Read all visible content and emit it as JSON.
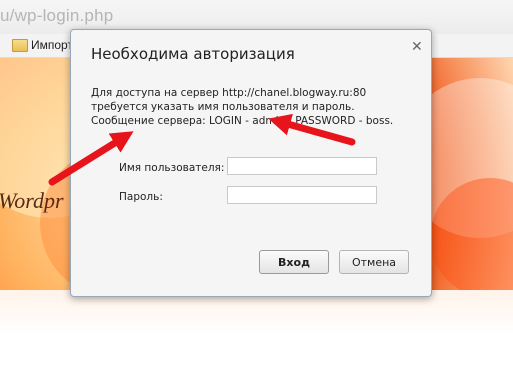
{
  "browser": {
    "address_text": "u/wp-login.php",
    "bookmark_label": "Импорт"
  },
  "page": {
    "text": "Wordpr"
  },
  "dialog": {
    "title": "Необходима авторизация",
    "message": "Для доступа на сервер http://chanel.blogway.ru:80 требуется указать имя пользователя и пароль. Сообщение сервера: LOGIN - admin , PASSWORD -  boss.",
    "username_label": "Имя пользователя:",
    "password_label": "Пароль:",
    "username_value": "",
    "password_value": "",
    "login_button": "Вход",
    "cancel_button": "Отмена"
  },
  "annotation": {
    "arrow_color": "#e8141c"
  }
}
